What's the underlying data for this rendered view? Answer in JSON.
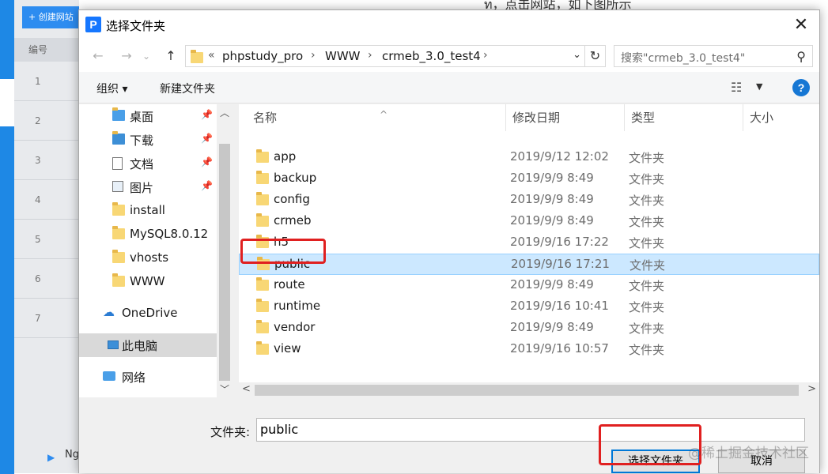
{
  "background": {
    "create_button": "+ 创建网站",
    "table_header": "编号",
    "row_numbers": [
      "1",
      "2",
      "3",
      "4",
      "5",
      "6",
      "7"
    ],
    "top_text": "ท，点击网站，如下图所示",
    "bottom_item": "Ng"
  },
  "dialog": {
    "title": "选择文件夹",
    "app_icon_letter": "P",
    "close_glyph": "✕",
    "nav": {
      "back": "←",
      "forward": "→",
      "dropdown": "⌄",
      "up": "↑",
      "path_prefix": "«",
      "path": [
        "phpstudy_pro",
        "WWW",
        "crmeb_3.0_test4"
      ],
      "refresh": "↻",
      "search_placeholder": "搜索\"crmeb_3.0_test4\""
    },
    "toolbar": {
      "organize": "组织 ▾",
      "new_folder": "新建文件夹",
      "view_glyph": "☷",
      "help": "?"
    },
    "nav_pane": [
      {
        "label": "桌面",
        "pinned": true,
        "icon": "desktop-folder-icon"
      },
      {
        "label": "下载",
        "pinned": true,
        "icon": "downloads-icon"
      },
      {
        "label": "文档",
        "pinned": true,
        "icon": "documents-icon"
      },
      {
        "label": "图片",
        "pinned": true,
        "icon": "pictures-icon"
      },
      {
        "label": "install",
        "pinned": false,
        "icon": "folder-icon"
      },
      {
        "label": "MySQL8.0.12",
        "pinned": false,
        "icon": "folder-icon"
      },
      {
        "label": "vhosts",
        "pinned": false,
        "icon": "folder-icon"
      },
      {
        "label": "WWW",
        "pinned": false,
        "icon": "folder-icon"
      },
      {
        "label": "OneDrive",
        "pinned": false,
        "icon": "onedrive-icon"
      },
      {
        "label": "此电脑",
        "pinned": false,
        "icon": "this-pc-icon",
        "selected": true
      },
      {
        "label": "网络",
        "pinned": false,
        "icon": "network-icon"
      }
    ],
    "columns": [
      "名称",
      "修改日期",
      "类型",
      "大小"
    ],
    "files": [
      {
        "name": "app",
        "date": "2019/9/12 12:02",
        "type": "文件夹"
      },
      {
        "name": "backup",
        "date": "2019/9/9 8:49",
        "type": "文件夹"
      },
      {
        "name": "config",
        "date": "2019/9/9 8:49",
        "type": "文件夹"
      },
      {
        "name": "crmeb",
        "date": "2019/9/9 8:49",
        "type": "文件夹"
      },
      {
        "name": "h5",
        "date": "2019/9/16 17:22",
        "type": "文件夹"
      },
      {
        "name": "public",
        "date": "2019/9/16 17:21",
        "type": "文件夹",
        "selected": true
      },
      {
        "name": "route",
        "date": "2019/9/9 8:49",
        "type": "文件夹"
      },
      {
        "name": "runtime",
        "date": "2019/9/16 10:41",
        "type": "文件夹"
      },
      {
        "name": "vendor",
        "date": "2019/9/9 8:49",
        "type": "文件夹"
      },
      {
        "name": "view",
        "date": "2019/9/16 10:57",
        "type": "文件夹"
      }
    ],
    "folder_label": "文件夹:",
    "folder_value": "public",
    "select_button": "选择文件夹",
    "cancel_button": "取消"
  },
  "watermark": "@稀土掘金技术社区",
  "colors": {
    "accent": "#0078d7",
    "selection": "#cce8ff",
    "highlight_box": "#e02020",
    "folder": "#f8d775"
  }
}
